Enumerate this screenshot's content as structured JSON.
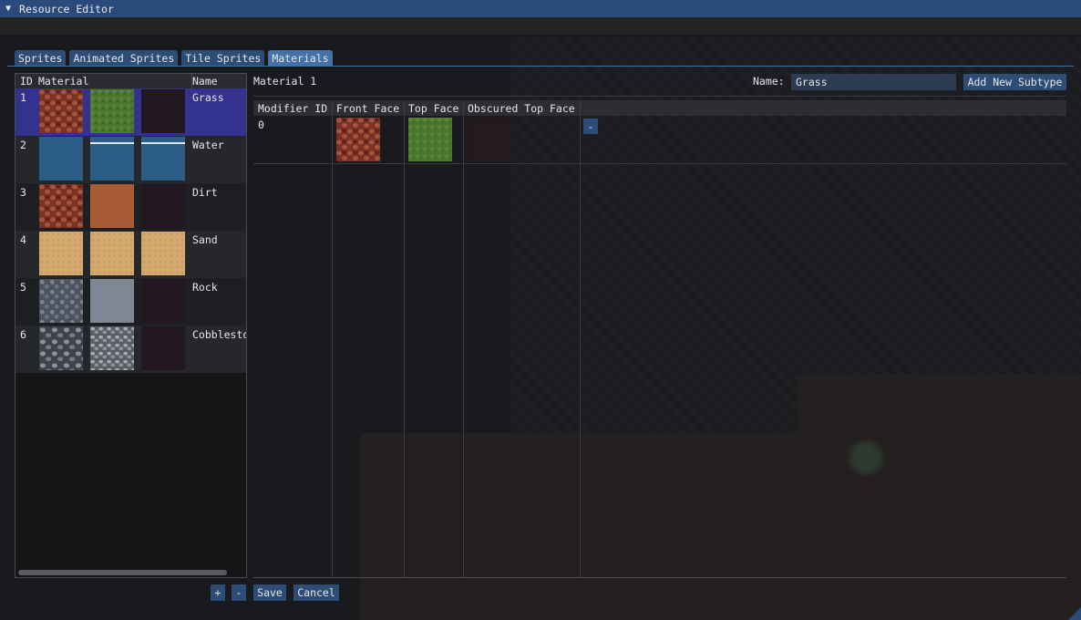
{
  "window": {
    "title": "Resource Editor"
  },
  "tabs": [
    {
      "label": "Sprites"
    },
    {
      "label": "Animated Sprites"
    },
    {
      "label": "Tile Sprites"
    },
    {
      "label": "Materials",
      "active": true
    }
  ],
  "material_list": {
    "columns": {
      "id": "ID",
      "material": "Material",
      "name": "Name"
    },
    "rows": [
      {
        "id": "1",
        "name": "Grass",
        "selected": true,
        "textures": [
          "red-cobble",
          "grass",
          "empty"
        ]
      },
      {
        "id": "2",
        "name": "Water",
        "textures": [
          "water",
          "water-surface",
          "water-surface"
        ]
      },
      {
        "id": "3",
        "name": "Dirt",
        "textures": [
          "red-cobble",
          "dirt",
          "empty"
        ]
      },
      {
        "id": "4",
        "name": "Sand",
        "textures": [
          "sand",
          "sand",
          "sand"
        ]
      },
      {
        "id": "5",
        "name": "Rock",
        "textures": [
          "grey-cobble",
          "rock",
          "empty"
        ]
      },
      {
        "id": "6",
        "name": "Cobblestone",
        "textures": [
          "cobblestone",
          "cobblestone-light",
          "empty"
        ]
      }
    ]
  },
  "detail": {
    "title": "Material 1",
    "name_label": "Name:",
    "name_value": "Grass",
    "add_subtype_label": "Add New Subtype",
    "table": {
      "columns": [
        "Modifier ID",
        "Front Face",
        "Top Face",
        "Obscured Top Face"
      ],
      "rows": [
        {
          "modifier_id": "0",
          "front": "red-cobble",
          "top": "grass",
          "obscured": "empty",
          "remove_label": "-"
        }
      ]
    }
  },
  "footer": {
    "add_label": "+",
    "remove_label": "-",
    "save_label": "Save",
    "cancel_label": "Cancel"
  },
  "colors": {
    "titlebar": "#294a7a",
    "button": "#2d4d76",
    "active_tab": "#4372a8",
    "selected_row": "#33338f"
  }
}
